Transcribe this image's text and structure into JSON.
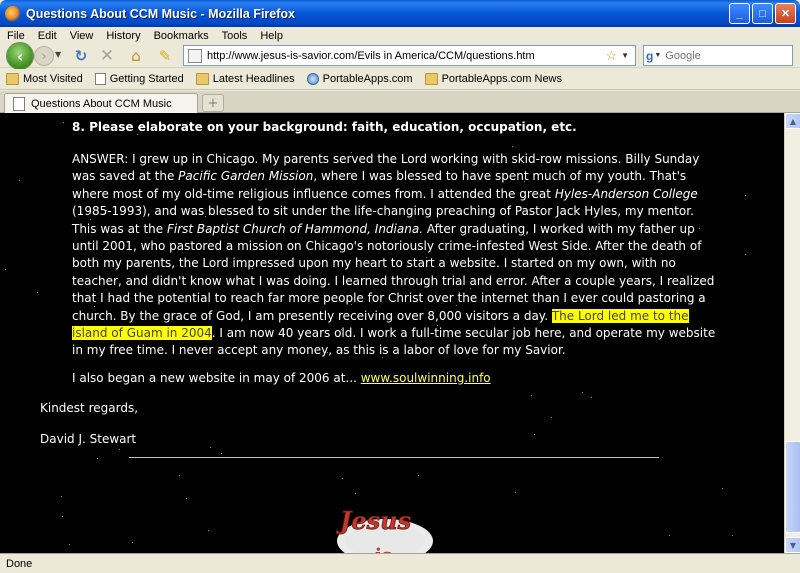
{
  "window": {
    "title": "Questions About CCM Music - Mozilla Firefox",
    "minimize": "_",
    "maximize": "□",
    "close": "✕"
  },
  "menu": [
    "File",
    "Edit",
    "View",
    "History",
    "Bookmarks",
    "Tools",
    "Help"
  ],
  "nav": {
    "url": "http://www.jesus-is-savior.com/Evils in America/CCM/questions.htm",
    "search_placeholder": "Google",
    "search_engine_letter": "g"
  },
  "bookmarks": [
    {
      "label": "Most Visited",
      "icon": "folder"
    },
    {
      "label": "Getting Started",
      "icon": "page"
    },
    {
      "label": "Latest Headlines",
      "icon": "folder"
    },
    {
      "label": "PortableApps.com",
      "icon": "globe"
    },
    {
      "label": "PortableApps.com News",
      "icon": "folder"
    }
  ],
  "tab": {
    "label": "Questions About CCM Music",
    "new_tab": "+"
  },
  "content": {
    "question": "8. Please elaborate on your background: faith, education, occupation, etc.",
    "answer_parts": [
      "ANSWER: I grew up in Chicago.  My parents served the Lord working with skid-row missions.  Billy Sunday was saved at the ",
      "Pacific Garden Mission",
      ", where I was blessed to have spent much of my youth.  That's where most of my old-time religious influence comes from.  I attended the great ",
      "Hyles-Anderson College",
      " (1985-1993), and was blessed to sit under the life-changing preaching of Pastor Jack Hyles, my mentor.  This was at the ",
      "First Baptist Church of Hammond, Indiana.",
      "  After graduating, I worked with my father up until 2001, who pastored a mission on Chicago's notoriously crime-infested West Side.  After the death of both my parents, the Lord impressed upon my heart to start a website.  I started on my own, with no teacher, and didn't know what I was doing.  I learned through trial and error.  After a couple years, I realized that I had the potential to reach far more people for Christ over the internet than I ever could pastoring a church.  By the grace of God, I am presently receiving over 8,000 visitors a day. ",
      "The Lord led me to the island of Guam in 2004",
      ".  I am now 40 years old.  I work a full-time secular job here, and operate my website in my free time.  I never accept any money, as this is a labor of love for my Savior."
    ],
    "also_text": "I also began a new website in may of 2006 at... ",
    "also_link": "www.soulwinning.info",
    "closing": "Kindest regards,",
    "signature": "David J. Stewart",
    "logo_text": "Jesus"
  },
  "status": "Done",
  "colors": {
    "page_bg": "#000000",
    "highlight": "#ffff00",
    "link": "#ffff66",
    "titlebar": "#0556d6"
  }
}
